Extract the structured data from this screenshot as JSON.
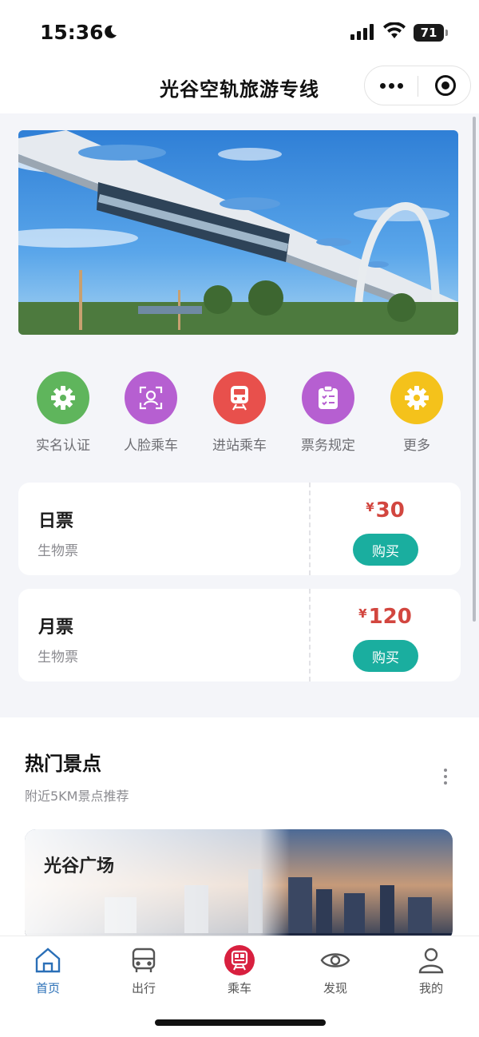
{
  "status_bar": {
    "time": "15:36",
    "battery": "71"
  },
  "nav": {
    "title": "光谷空轨旅游专线"
  },
  "quick_actions": [
    {
      "label": "实名认证",
      "color": "#5fb55c",
      "icon": "gear-icon"
    },
    {
      "label": "人脸乘车",
      "color": "#b65fd1",
      "icon": "face-scan-icon"
    },
    {
      "label": "进站乘车",
      "color": "#e8504c",
      "icon": "train-icon"
    },
    {
      "label": "票务规定",
      "color": "#b65fd1",
      "icon": "clipboard-icon"
    },
    {
      "label": "更多",
      "color": "#f4c21b",
      "icon": "gear-icon"
    }
  ],
  "tickets": [
    {
      "name": "日票",
      "sub": "生物票",
      "currency": "¥",
      "price": "30",
      "buy": "购买"
    },
    {
      "name": "月票",
      "sub": "生物票",
      "currency": "¥",
      "price": "120",
      "buy": "购买"
    }
  ],
  "hot": {
    "title": "热门景点",
    "subtitle": "附近5KM景点推荐",
    "spot_name": "光谷广场"
  },
  "tabs": [
    {
      "label": "首页",
      "icon": "home-icon",
      "active": true
    },
    {
      "label": "出行",
      "icon": "bus-icon",
      "active": false
    },
    {
      "label": "乘车",
      "icon": "ride-qr-icon",
      "active": false
    },
    {
      "label": "发现",
      "icon": "eye-icon",
      "active": false
    },
    {
      "label": "我的",
      "icon": "user-icon",
      "active": false
    }
  ],
  "colors": {
    "accent": "#1aae9f",
    "price": "#d2463f",
    "active_tab": "#2a6fb7",
    "ride_red": "#d8203f"
  }
}
